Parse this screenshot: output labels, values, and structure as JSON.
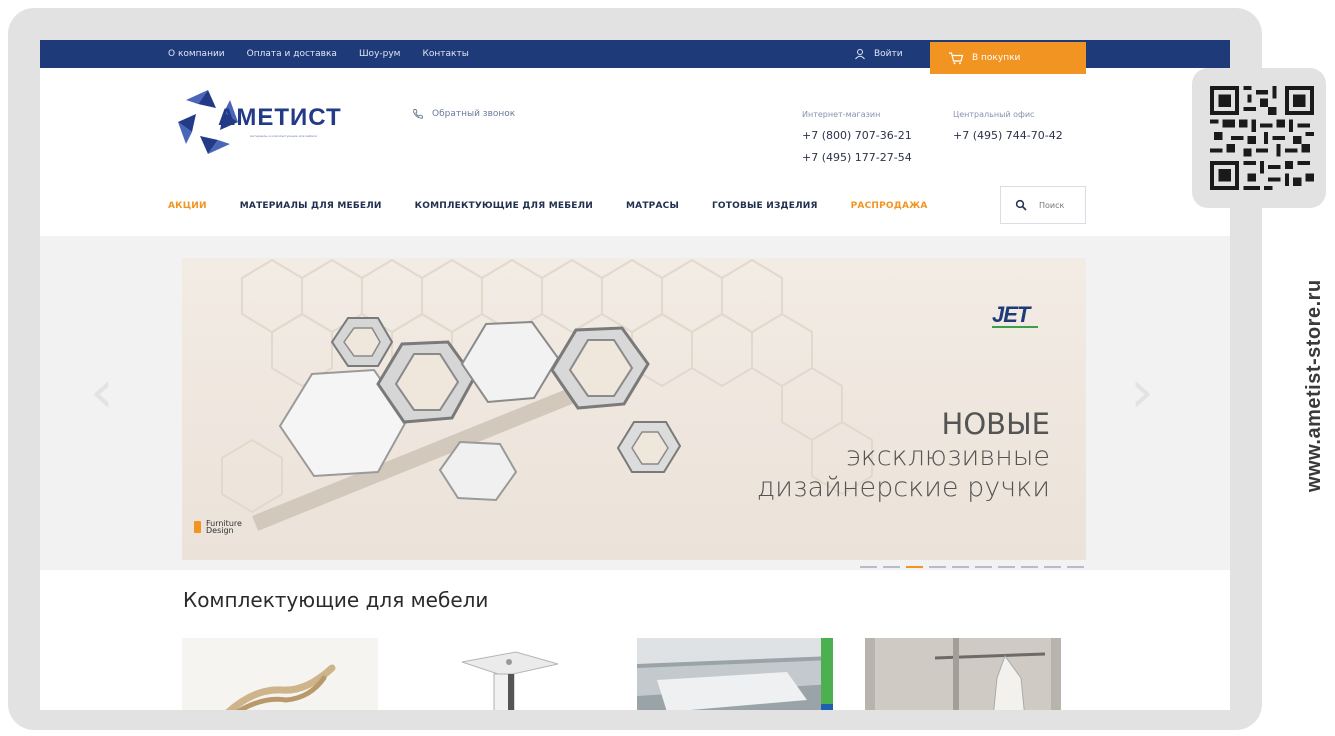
{
  "topbar": {
    "nav": [
      "О компании",
      "Оплата и доставка",
      "Шоу-рум",
      "Контакты"
    ],
    "login_label": "Войти",
    "cart_label": "В покупки"
  },
  "header": {
    "logo_text": "АМЕТИСТ",
    "logo_subtitle": "материалы и комплектующие для мебели",
    "callback_label": "Обратный звонок",
    "shop": {
      "label": "Интернет-магазин",
      "phone1": "+7 (800) 707-36-21",
      "phone2": "+7 (495) 177-27-54"
    },
    "office": {
      "label": "Центральный офис",
      "phone": "+7 (495) 744-70-42"
    }
  },
  "mainnav": {
    "items": [
      "АКЦИИ",
      "МАТЕРИАЛЫ ДЛЯ МЕБЕЛИ",
      "КОМПЛЕКТУЮЩИЕ ДЛЯ МЕБЕЛИ",
      "МАТРАСЫ",
      "ГОТОВЫЕ ИЗДЕЛИЯ",
      "РАСПРОДАЖА"
    ],
    "search_placeholder": "Поиск"
  },
  "banner": {
    "brand": "JET",
    "headline_line1": "НОВЫЕ",
    "headline_line2": "эксклюзивные",
    "headline_line3": "дизайнерские ручки",
    "corner_logo_line1": "Furniture",
    "corner_logo_line2": "Design",
    "slide_count": 10,
    "active_slide": 3
  },
  "section": {
    "title": "Комплектующие для мебели"
  },
  "sidebar": {
    "url": "www.ametist-store.ru"
  },
  "colors": {
    "topbar": "#1f3a78",
    "accent": "#f29422",
    "text_dark": "#22304f"
  },
  "icons": [
    "user-icon",
    "cart-icon",
    "phone-icon",
    "search-icon",
    "arrow-left-icon",
    "arrow-right-icon",
    "qr-code-icon"
  ]
}
